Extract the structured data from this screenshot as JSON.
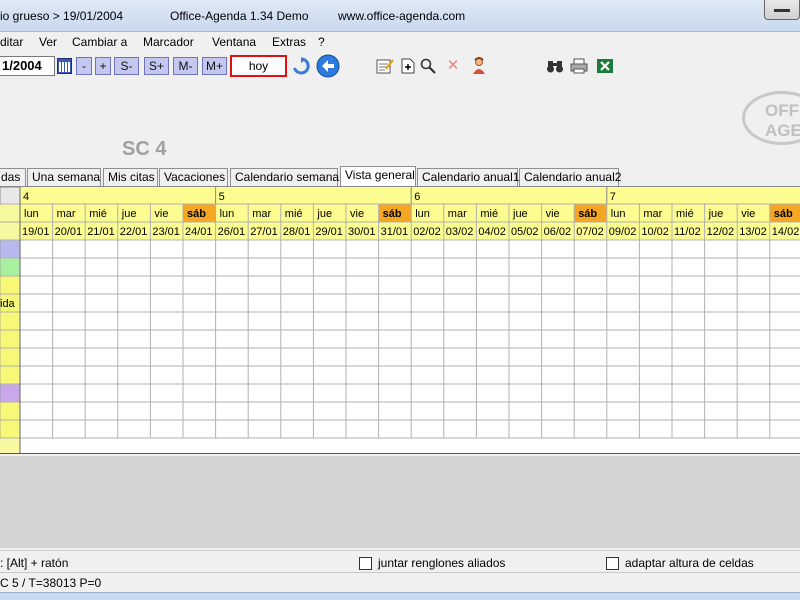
{
  "titlebar": {
    "file": "io grueso > 19/01/2004",
    "app": "Office-Agenda 1.34 Demo",
    "url": "www.office-agenda.com"
  },
  "menu": [
    "ditar",
    "Ver",
    "Cambiar a",
    "Marcador",
    "Ventana",
    "Extras",
    "?"
  ],
  "toolbar": {
    "date_value": "1/2004",
    "nav_buttons": [
      "-",
      "+",
      "S-",
      "S+",
      "M-",
      "M+"
    ],
    "today_label": "hoy"
  },
  "logo_text": [
    "OFF",
    "AGE"
  ],
  "section_label": "SC 4",
  "tabs": [
    "das",
    "Una semana",
    "Mis citas",
    "Vacaciones",
    "Calendario semanal",
    "Vista general",
    "Calendario anual1",
    "Calendario anual2"
  ],
  "active_tab": "Vista general",
  "overview": {
    "weeks": [
      "4",
      "5",
      "6",
      "7"
    ],
    "weekdays": [
      "lun",
      "mar",
      "mié",
      "jue",
      "vie",
      "sáb"
    ],
    "dates": [
      "19/01",
      "20/01",
      "21/01",
      "22/01",
      "23/01",
      "24/01",
      "26/01",
      "27/01",
      "28/01",
      "29/01",
      "30/01",
      "31/01",
      "02/02",
      "03/02",
      "04/02",
      "05/02",
      "06/02",
      "07/02",
      "09/02",
      "10/02",
      "11/02",
      "12/02",
      "13/02",
      "14/02"
    ],
    "row_labels": [
      "",
      "",
      "",
      "ida",
      "",
      "",
      "",
      "",
      "",
      "",
      ""
    ],
    "row_colors": [
      "#b8b8ee",
      "#a8f0a0",
      "#f8f878",
      "#f8f878",
      "#f8f878",
      "#f8f878",
      "#f8f878",
      "#f8f878",
      "#c8a8e8",
      "#f8f878",
      "#f8f878"
    ],
    "colors": {
      "header_yellow": "#fcfc90",
      "saturday": "#f5a623",
      "grid_line": "#b0b0b0"
    }
  },
  "status": {
    "hint": ": [Alt] + ratón",
    "check_join": "juntar renglones aliados",
    "check_adapt": "adaptar altura de celdas",
    "info": "C 5 / T=38013  P=0"
  }
}
